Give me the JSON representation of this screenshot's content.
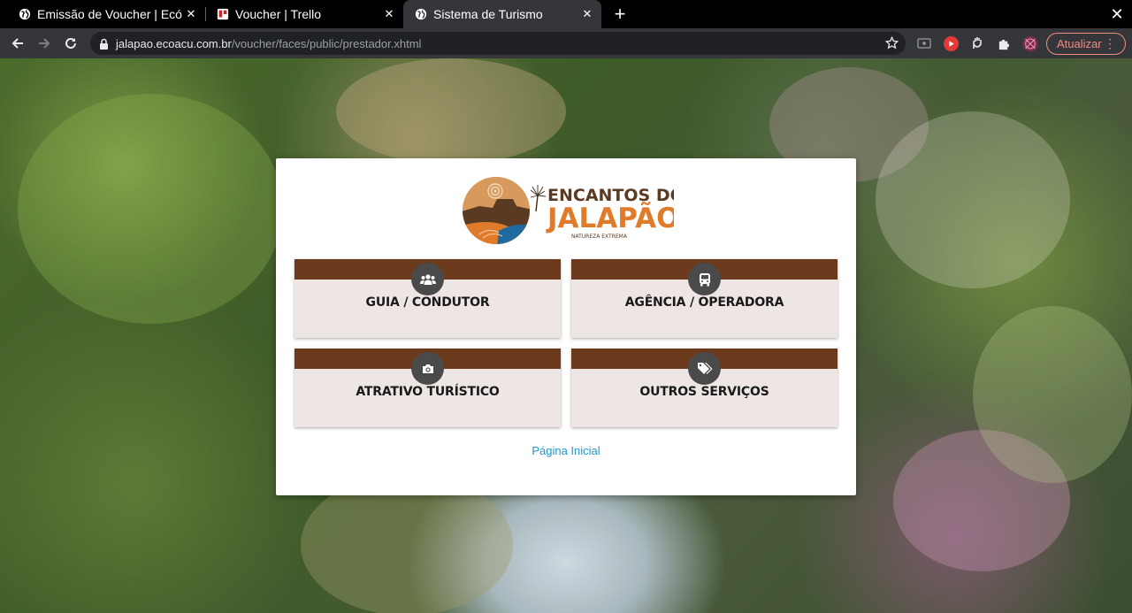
{
  "browser": {
    "tabs": [
      {
        "title": "Emissão de Voucher | Ecó",
        "icon": "globe-icon",
        "active": false
      },
      {
        "title": "Voucher | Trello",
        "icon": "trello-icon",
        "active": false
      },
      {
        "title": "Sistema de Turismo",
        "icon": "globe-icon",
        "active": true
      }
    ],
    "new_tab": "+",
    "close_window": "✕",
    "url_host": "jalapao.ecoacu.com.br",
    "url_path": "/voucher/faces/public/prestador.xhtml",
    "update_label": "Atualizar",
    "accent": "#f28b82"
  },
  "logo": {
    "line1": "ENCANTOS DO",
    "line2": "JALAPÃO",
    "tagline": "NATUREZA   EXTREMA",
    "colors": {
      "orange": "#e07b2c",
      "brown": "#5a3a22"
    }
  },
  "tiles": [
    {
      "label": "GUIA / CONDUTOR",
      "icon": "group-icon"
    },
    {
      "label": "AGÊNCIA / OPERADORA",
      "icon": "bus-icon"
    },
    {
      "label": "ATRATIVO TURÍSTICO",
      "icon": "camera-icon"
    },
    {
      "label": "OUTROS SERVIÇOS",
      "icon": "tags-icon"
    }
  ],
  "home_link": "Página Inicial",
  "colors": {
    "band": "#6b3a1c",
    "tile_bg": "#ede6e4",
    "link": "#2196d3"
  }
}
